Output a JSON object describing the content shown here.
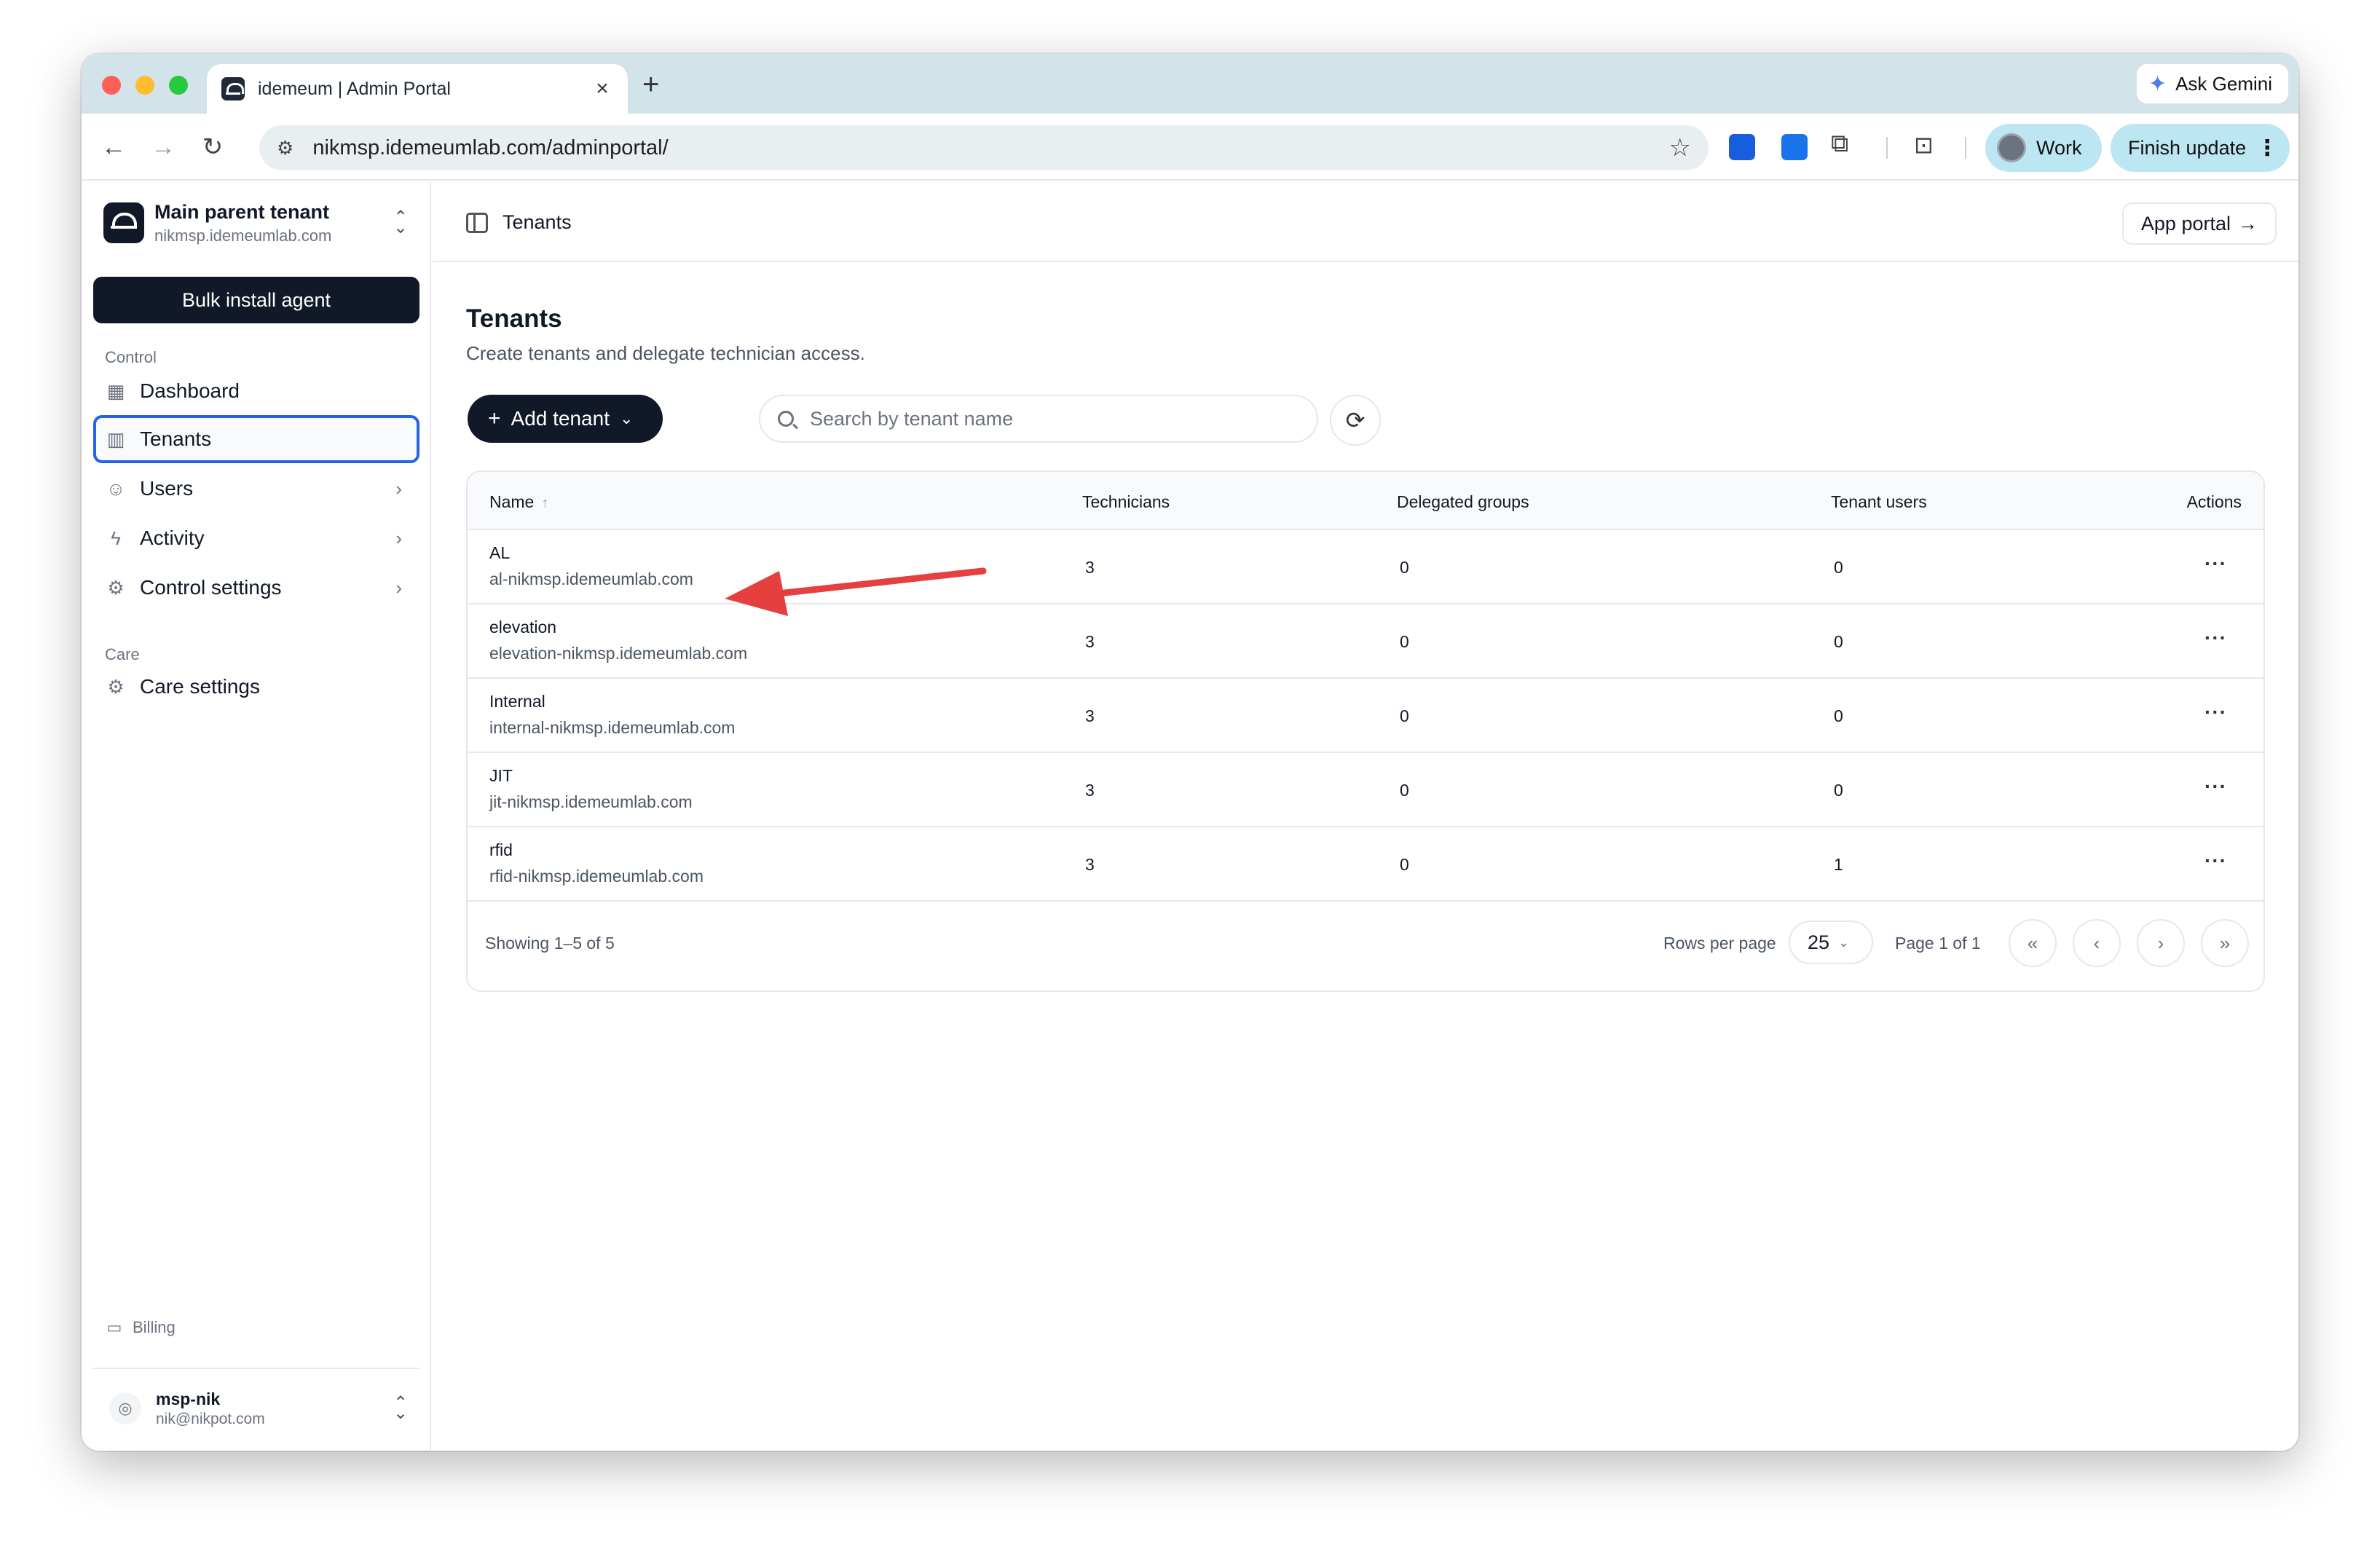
{
  "browser": {
    "tab_title": "idemeum | Admin Portal",
    "tab_close": "×",
    "new_tab": "+",
    "gemini_label": "Ask Gemini",
    "url": "nikmsp.idemeumlab.com/adminportal/",
    "profile_label": "Work",
    "finish_update_label": "Finish update"
  },
  "sidebar": {
    "tenant_name": "Main parent tenant",
    "tenant_domain": "nikmsp.idemeumlab.com",
    "bulk_install_label": "Bulk install agent",
    "control_label": "Control",
    "items": [
      {
        "label": "Dashboard",
        "icon": "dashboard-icon"
      },
      {
        "label": "Tenants",
        "icon": "building-icon",
        "active": true
      },
      {
        "label": "Users",
        "icon": "users-icon"
      },
      {
        "label": "Activity",
        "icon": "bolt-icon"
      },
      {
        "label": "Control settings",
        "icon": "gear-icon"
      }
    ],
    "care_label": "Care",
    "care_items": [
      {
        "label": "Care settings",
        "icon": "gear-icon"
      }
    ],
    "billing_label": "Billing",
    "user_name": "msp-nik",
    "user_email": "nik@nikpot.com"
  },
  "topbar": {
    "breadcrumb": "Tenants",
    "app_portal_label": "App portal",
    "app_portal_arrow": "→"
  },
  "page": {
    "title": "Tenants",
    "subtitle": "Create tenants and delegate technician access.",
    "add_tenant_label": "Add tenant",
    "search_placeholder": "Search by tenant name"
  },
  "table": {
    "columns": {
      "name": "Name",
      "technicians": "Technicians",
      "delegated_groups": "Delegated groups",
      "tenant_users": "Tenant users",
      "actions": "Actions"
    },
    "rows": [
      {
        "name": "AL",
        "domain": "al-nikmsp.idemeumlab.com",
        "technicians": "3",
        "delegated_groups": "0",
        "tenant_users": "0"
      },
      {
        "name": "elevation",
        "domain": "elevation-nikmsp.idemeumlab.com",
        "technicians": "3",
        "delegated_groups": "0",
        "tenant_users": "0"
      },
      {
        "name": "Internal",
        "domain": "internal-nikmsp.idemeumlab.com",
        "technicians": "3",
        "delegated_groups": "0",
        "tenant_users": "0"
      },
      {
        "name": "JIT",
        "domain": "jit-nikmsp.idemeumlab.com",
        "technicians": "3",
        "delegated_groups": "0",
        "tenant_users": "0"
      },
      {
        "name": "rfid",
        "domain": "rfid-nikmsp.idemeumlab.com",
        "technicians": "3",
        "delegated_groups": "0",
        "tenant_users": "1"
      }
    ],
    "actions_glyph": "···",
    "showing": "Showing 1–5 of 5",
    "rows_per_page_label": "Rows per page",
    "rows_per_page_value": "25",
    "page_info": "Page 1 of 1"
  },
  "colors": {
    "accent": "#2563eb",
    "primary_button": "#111827",
    "annotation_arrow": "#e5403f",
    "chrome_tabstrip": "#d3e3ea",
    "chrome_pill": "#bde6f3"
  }
}
